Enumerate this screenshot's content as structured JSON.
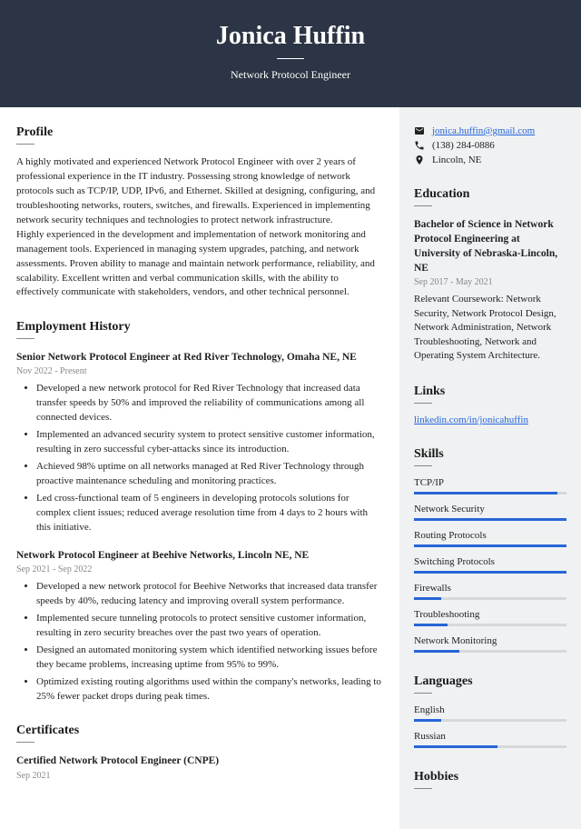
{
  "header": {
    "name": "Jonica Huffin",
    "title": "Network Protocol Engineer"
  },
  "profile": {
    "heading": "Profile",
    "text": "A highly motivated and experienced Network Protocol Engineer with over 2 years of professional experience in the IT industry. Possessing strong knowledge of network protocols such as TCP/IP, UDP, IPv6, and Ethernet. Skilled at designing, configuring, and troubleshooting networks, routers, switches, and firewalls. Experienced in implementing network security techniques and technologies to protect network infrastructure.\nHighly experienced in the development and implementation of network monitoring and management tools. Experienced in managing system upgrades, patching, and network assessments. Proven ability to manage and maintain network performance, reliability, and scalability. Excellent written and verbal communication skills, with the ability to effectively communicate with stakeholders, vendors, and other technical personnel."
  },
  "employment": {
    "heading": "Employment History",
    "jobs": [
      {
        "title": "Senior Network Protocol Engineer at Red River Technology, Omaha NE, NE",
        "date": "Nov 2022 - Present",
        "bullets": [
          "Developed a new network protocol for Red River Technology that increased data transfer speeds by 50% and improved the reliability of communications among all connected devices.",
          "Implemented an advanced security system to protect sensitive customer information, resulting in zero successful cyber-attacks since its introduction.",
          "Achieved 98% uptime on all networks managed at Red River Technology through proactive maintenance scheduling and monitoring practices.",
          "Led cross-functional team of 5 engineers in developing protocols solutions for complex client issues; reduced average resolution time from 4 days to 2 hours with this initiative."
        ]
      },
      {
        "title": "Network Protocol Engineer at Beehive Networks, Lincoln NE, NE",
        "date": "Sep 2021 - Sep 2022",
        "bullets": [
          "Developed a new network protocol for Beehive Networks that increased data transfer speeds by 40%, reducing latency and improving overall system performance.",
          "Implemented secure tunneling protocols to protect sensitive customer information, resulting in zero security breaches over the past two years of operation.",
          "Designed an automated monitoring system which identified networking issues before they became problems, increasing uptime from 95% to 99%.",
          "Optimized existing routing algorithms used within the company's networks, leading to 25% fewer packet drops during peak times."
        ]
      }
    ]
  },
  "certificates": {
    "heading": "Certificates",
    "items": [
      {
        "title": "Certified Network Protocol Engineer (CNPE)",
        "date": "Sep 2021"
      }
    ]
  },
  "contact": {
    "email": "jonica.huffin@gmail.com",
    "phone": "(138) 284-0886",
    "location": "Lincoln, NE"
  },
  "education": {
    "heading": "Education",
    "degree": "Bachelor of Science in Network Protocol Engineering at University of Nebraska-Lincoln, NE",
    "date": "Sep 2017 - May 2021",
    "desc": "Relevant Coursework: Network Security, Network Protocol Design, Network Administration, Network Troubleshooting, Network and Operating System Architecture."
  },
  "links": {
    "heading": "Links",
    "items": [
      "linkedin.com/in/jonicahuffin"
    ]
  },
  "skills": {
    "heading": "Skills",
    "items": [
      {
        "name": "TCP/IP",
        "level": 94
      },
      {
        "name": "Network Security",
        "level": 100
      },
      {
        "name": "Routing Protocols",
        "level": 100
      },
      {
        "name": "Switching Protocols",
        "level": 100
      },
      {
        "name": "Firewalls",
        "level": 18
      },
      {
        "name": "Troubleshooting",
        "level": 22
      },
      {
        "name": "Network Monitoring",
        "level": 30
      }
    ]
  },
  "languages": {
    "heading": "Languages",
    "items": [
      {
        "name": "English",
        "level": 18
      },
      {
        "name": "Russian",
        "level": 55
      }
    ]
  },
  "hobbies": {
    "heading": "Hobbies"
  }
}
